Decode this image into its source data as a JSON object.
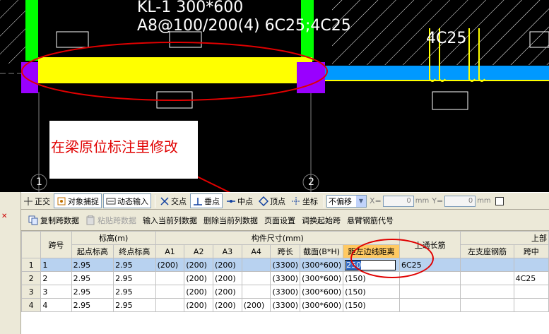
{
  "cad": {
    "beam_label_line1": "KL-1 300*600",
    "beam_label_line2": "A8@100/200(4) 6C25;4C25",
    "rebar_label": "4C25",
    "axis_1": "1",
    "axis_2": "2",
    "callout_text": "在梁原位标注里修改",
    "colors": {
      "background": "#000000",
      "green_column": "#00ff00",
      "yellow_beam": "#ffff00",
      "blue_beam": "#0099ff",
      "purple_support": "#9900ff",
      "annotation_red": "#e00000"
    }
  },
  "snapbar": {
    "items": [
      {
        "label": "正交",
        "icon": "ortho-icon",
        "toggled": false
      },
      {
        "label": "对象捕捉",
        "icon": "object-snap-icon",
        "toggled": true
      },
      {
        "label": "动态输入",
        "icon": "dynamic-input-icon",
        "toggled": true
      },
      {
        "label": "交点",
        "icon": "intersection-icon",
        "toggled": false
      },
      {
        "label": "垂点",
        "icon": "perpendicular-icon",
        "toggled": true
      },
      {
        "label": "中点",
        "icon": "midpoint-icon",
        "toggled": false
      },
      {
        "label": "顶点",
        "icon": "vertex-icon",
        "toggled": false
      },
      {
        "label": "坐标",
        "icon": "coordinate-icon",
        "toggled": false
      }
    ],
    "offset_select": "不偏移",
    "x_label": "X=",
    "x_value": "0",
    "y_label": "Y=",
    "y_value": "0",
    "unit": "mm"
  },
  "panel_toolbar": {
    "buttons": [
      {
        "label": "复制跨数据",
        "icon": "copy-icon",
        "disabled": false
      },
      {
        "label": "粘贴跨数据",
        "icon": "paste-icon",
        "disabled": true
      },
      {
        "label": "输入当前列数据",
        "disabled": false
      },
      {
        "label": "删除当前列数据",
        "disabled": false
      },
      {
        "label": "页面设置",
        "disabled": false
      },
      {
        "label": "调换起始跨",
        "disabled": false
      },
      {
        "label": "悬臂钢筋代号",
        "disabled": false
      }
    ]
  },
  "table": {
    "group_headers": {
      "span_no": "跨号",
      "elevation": "标高(m)",
      "dimensions": "构件尺寸(mm)",
      "top_through": "上通长筋",
      "top_bar": "上部"
    },
    "columns": [
      "起点标高",
      "终点标高",
      "A1",
      "A2",
      "A3",
      "A4",
      "跨长",
      "截面(B*H)",
      "距左边线距离",
      "左支座钢筋",
      "跨中"
    ],
    "rows": [
      {
        "idx": "1",
        "span": "1",
        "start": "2.95",
        "end": "2.95",
        "a1": "(200)",
        "a2": "(200)",
        "a3": "(200)",
        "a4": "",
        "len": "(3300)",
        "sec": "(300*600)",
        "dist": "250",
        "through": "6C25",
        "left": "",
        "mid": ""
      },
      {
        "idx": "2",
        "span": "2",
        "start": "2.95",
        "end": "2.95",
        "a1": "",
        "a2": "(200)",
        "a3": "(200)",
        "a4": "",
        "len": "(3300)",
        "sec": "(300*600)",
        "dist": "(150)",
        "through": "",
        "left": "",
        "mid": "4C25"
      },
      {
        "idx": "3",
        "span": "3",
        "start": "2.95",
        "end": "2.95",
        "a1": "",
        "a2": "(200)",
        "a3": "(200)",
        "a4": "",
        "len": "(3300)",
        "sec": "(300*600)",
        "dist": "(150)",
        "through": "",
        "left": "",
        "mid": ""
      },
      {
        "idx": "4",
        "span": "4",
        "start": "2.95",
        "end": "2.95",
        "a1": "",
        "a2": "(200)",
        "a3": "(200)",
        "a4": "(200)",
        "len": "(3300)",
        "sec": "(300*600)",
        "dist": "(150)",
        "through": "",
        "left": "",
        "mid": ""
      }
    ]
  }
}
